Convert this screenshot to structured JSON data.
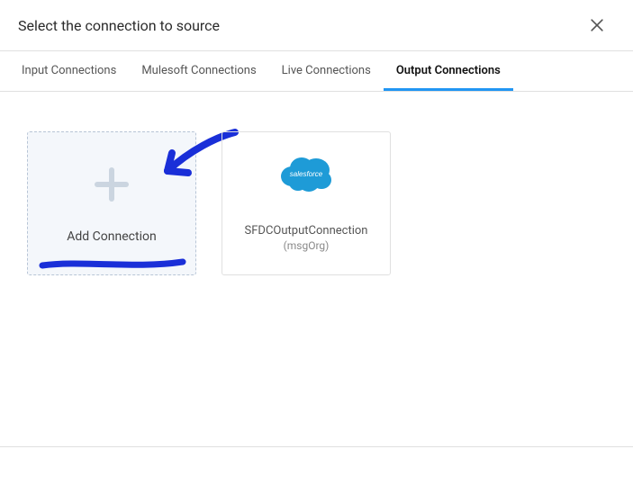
{
  "modal": {
    "title": "Select the connection to source"
  },
  "tabs": {
    "input": "Input Connections",
    "mulesoft": "Mulesoft Connections",
    "live": "Live Connections",
    "output": "Output Connections"
  },
  "cards": {
    "add_label": "Add Connection",
    "sfdc": {
      "name": "SFDCOutputConnection",
      "org": "(msgOrg)",
      "logo_text": "salesforce"
    }
  },
  "colors": {
    "accent": "#2196f3",
    "salesforce": "#1e9bd7",
    "annotation": "#1a2fd8"
  }
}
